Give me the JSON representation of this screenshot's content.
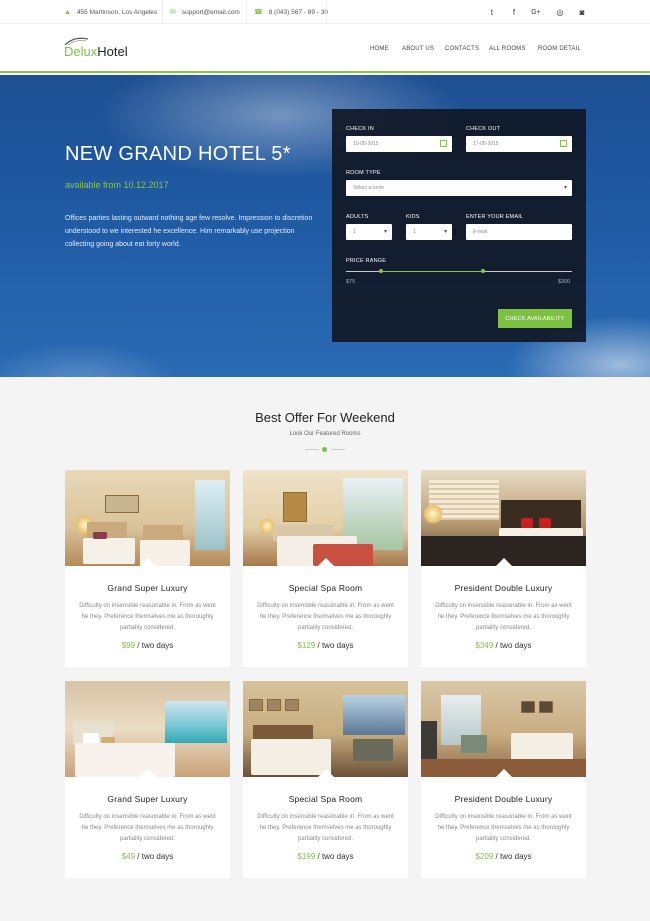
{
  "topbar": {
    "address": "455 Martinson, Los Angeles",
    "email": "support@email.com",
    "phone": "8 (043) 567 - 89 - 30",
    "address_icon": "map-marker-icon",
    "email_icon": "envelope-icon",
    "phone_icon": "phone-icon",
    "social": [
      {
        "icon": "twitter-icon",
        "glyph": "t"
      },
      {
        "icon": "facebook-icon",
        "glyph": "f"
      },
      {
        "icon": "google-plus-icon",
        "glyph": "G+"
      },
      {
        "icon": "dribbble-icon",
        "glyph": "◎"
      },
      {
        "icon": "instagram-icon",
        "glyph": "◙"
      }
    ]
  },
  "header": {
    "logo_part1": "Delux",
    "logo_part2": "Hotel",
    "nav": [
      "HOME",
      "ABOUT US",
      "CONTACTS",
      "ALL ROOMS",
      "ROOM DETAIL"
    ]
  },
  "hero": {
    "title": "NEW GRAND HOTEL 5*",
    "subtitle": "available from 10.12.2017",
    "text": "Offices parties lasting outward nothing age few resolve. Impression to discretion understood to we interested he excellence. Him remarkably use projection collecting going about eat forty world."
  },
  "booking": {
    "check_in_label": "CHECK IN",
    "check_in_value": "10-05-2015",
    "check_out_label": "CHECK OUT",
    "check_out_value": "17-05-2015",
    "room_type_label": "ROOM TYPE",
    "room_type_value": "Select a room",
    "adults_label": "ADULTS",
    "adults_value": "1",
    "kids_label": "KIDS",
    "kids_value": "1",
    "email_label": "ENTER YOUR EMAIL",
    "email_placeholder": "E-mail",
    "price_range_label": "PRICE RANGE",
    "range_min": "$75",
    "range_max": "$300",
    "range_low_fraction": 0.15,
    "range_high_fraction": 0.6,
    "button": "CHECK AVAILABILITY"
  },
  "offers": {
    "title": "Best Offer For Weekend",
    "subtitle": "Look Our Featured Rooms",
    "per": "/ two days",
    "rooms": [
      {
        "name": "Grand Super Luxury",
        "desc": "Difficulty on insensible reasonable in. From as went he they. Preference themselves me as thoroughly partiality considered.",
        "price": "$99"
      },
      {
        "name": "Special Spa Room",
        "desc": "Difficulty on insensible reasonable in. From as went he they. Preference themselves me as thoroughly partiality considered.",
        "price": "$129"
      },
      {
        "name": "President Double Luxury",
        "desc": "Difficulty on insensible reasonable in. From as went he they. Preference themselves me as thoroughly partiality considered.",
        "price": "$349"
      },
      {
        "name": "Grand Super Luxury",
        "desc": "Difficulty on insensible reasonable in. From as went he they. Preference themselves me as thoroughly partiality considered.",
        "price": "$49"
      },
      {
        "name": "Special Spa Room",
        "desc": "Difficulty on insensible reasonable in. From as went he they. Preference themselves me as thoroughly partiality considered.",
        "price": "$199"
      },
      {
        "name": "President Double Luxury",
        "desc": "Difficulty on insensible reasonable in. From as went he they. Preference themselves me as thoroughly partiality considered.",
        "price": "$209"
      }
    ]
  },
  "colors": {
    "accent": "#7dc142",
    "form_bg": "#111826",
    "hero_blue": "#1f5aa3"
  }
}
